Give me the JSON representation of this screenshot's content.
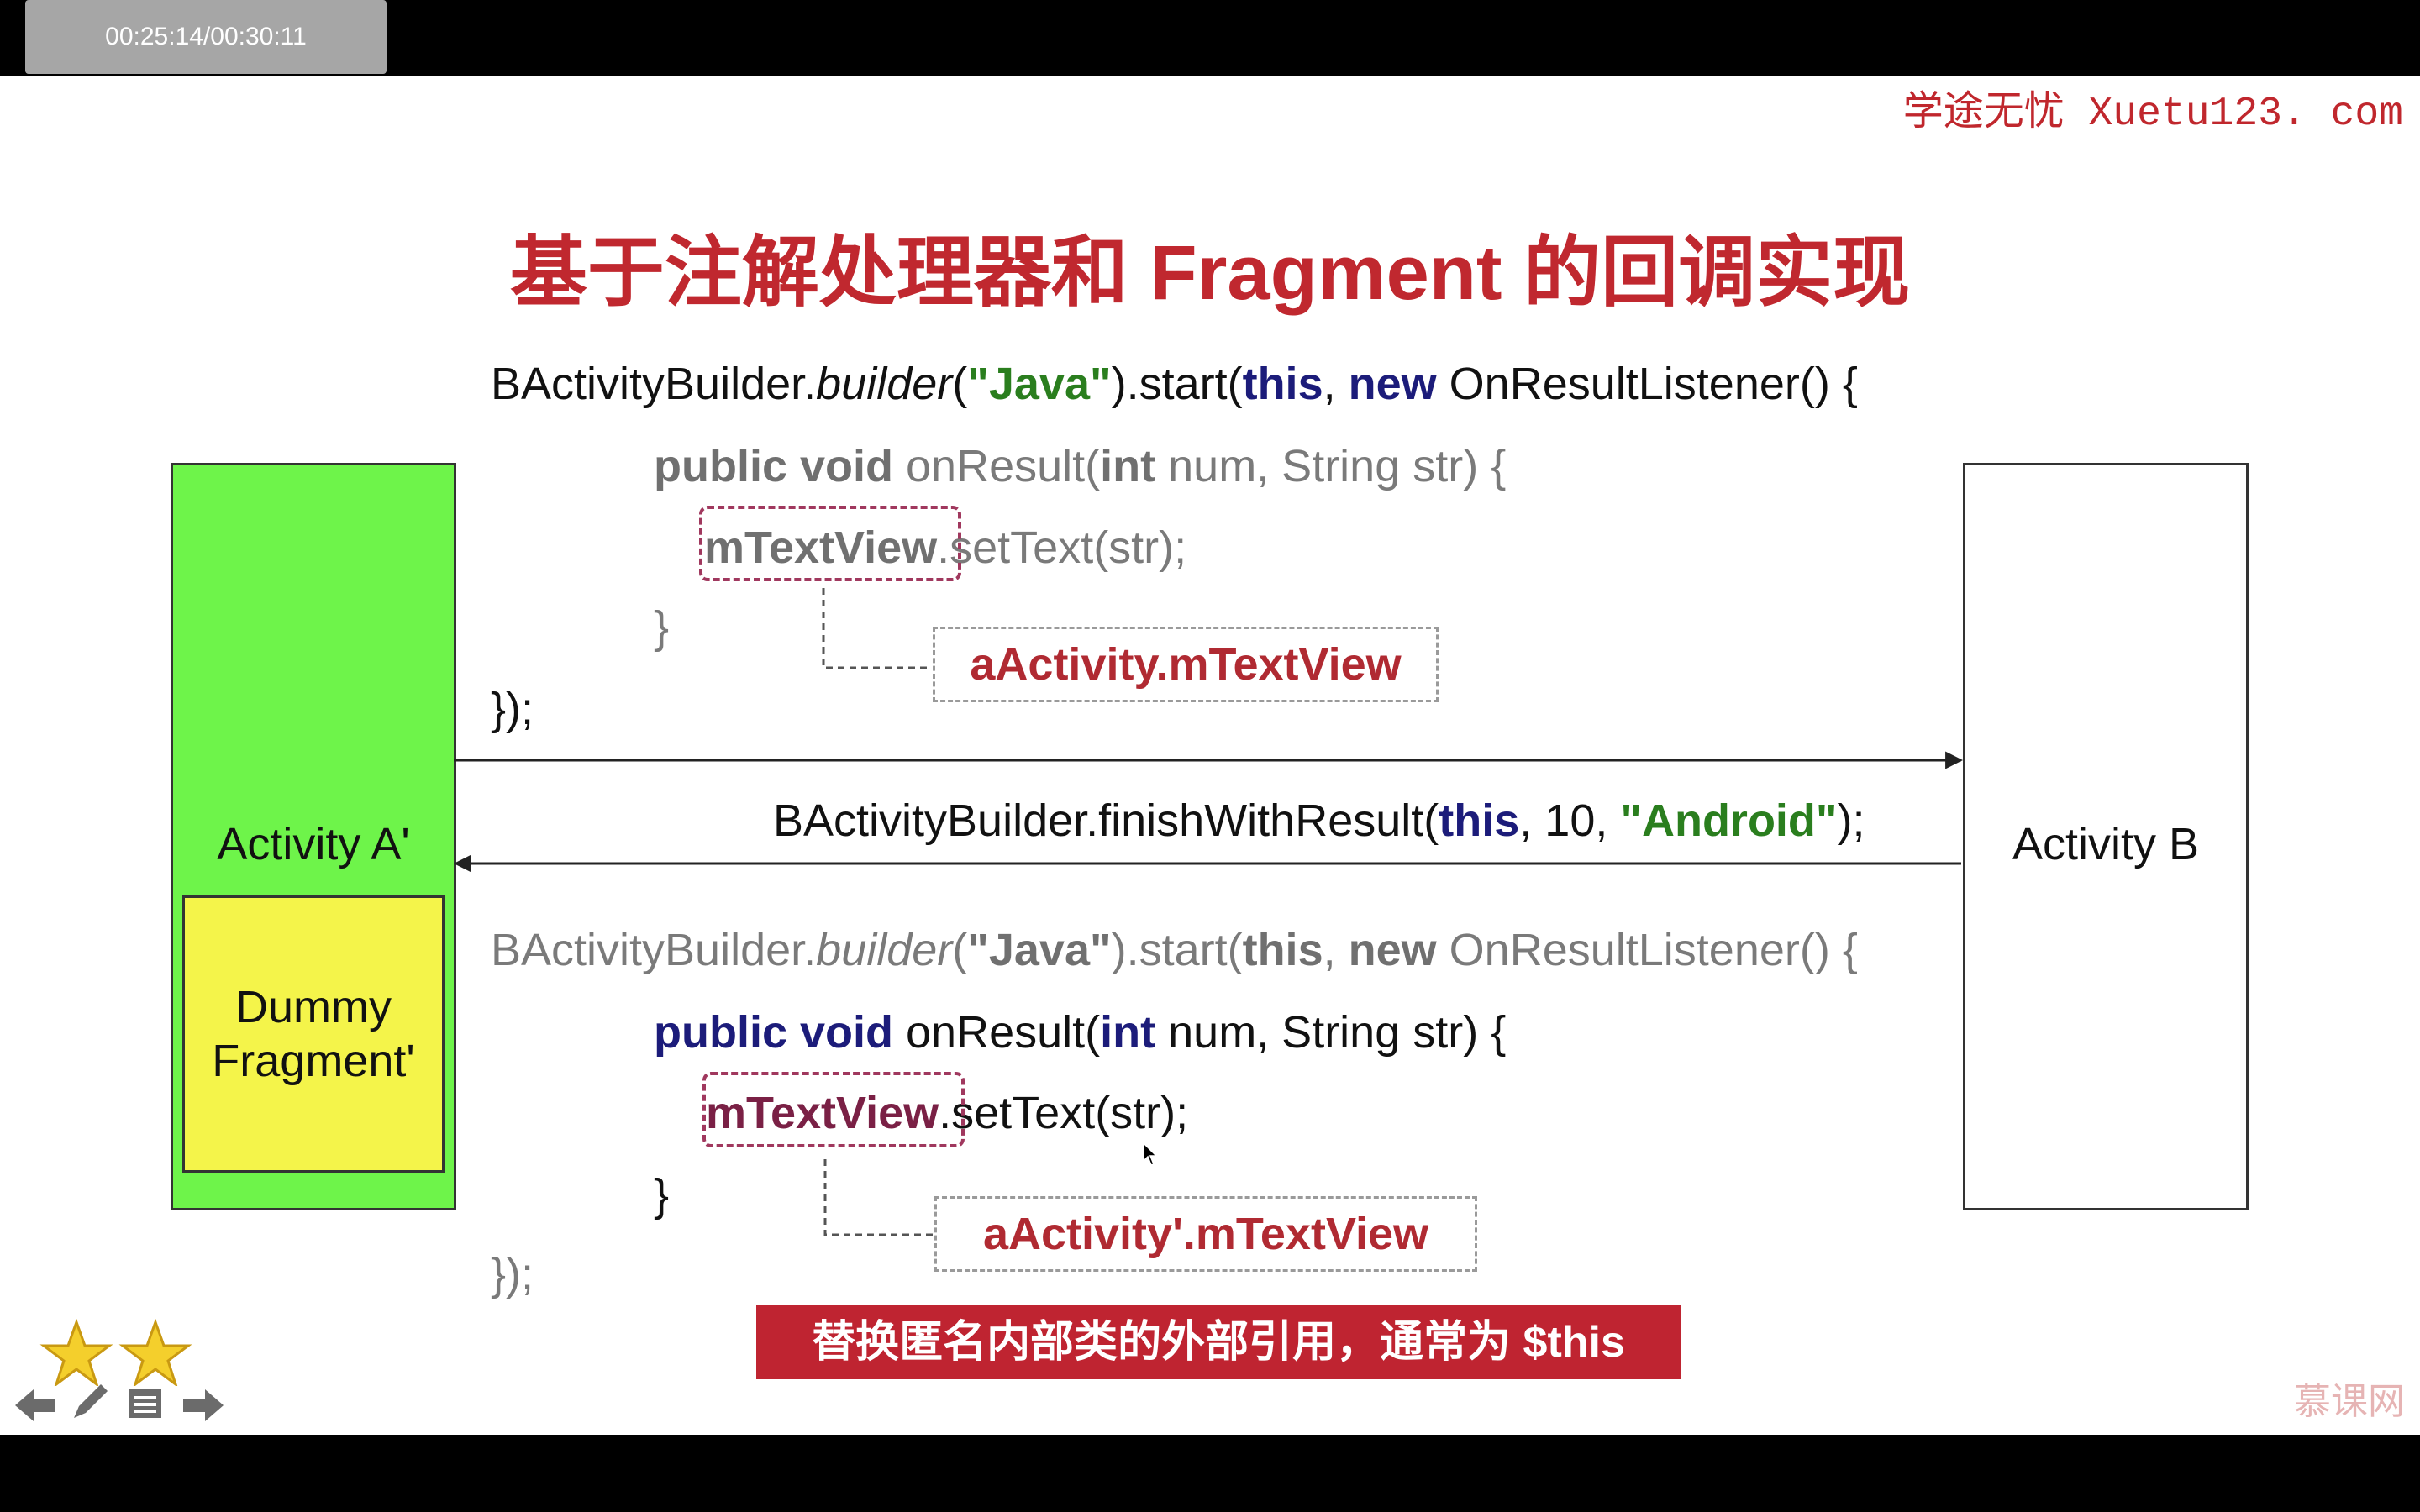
{
  "player": {
    "time": "00:25:14/00:30:11"
  },
  "watermark": {
    "brand": "学途无忧  Xuetu123. com",
    "logo": "慕课网"
  },
  "slide": {
    "title": "基于注解处理器和 Fragment 的回调实现",
    "activity_a": "Activity A'",
    "dummy_fragment": "Dummy Fragment'",
    "activity_b": "Activity B",
    "top_code": {
      "l1_a": "BActivityBuilder.",
      "l1_b": "builder",
      "l1_c": "(",
      "l1_str": "\"Java\"",
      "l1_d": ").start(",
      "l1_this": "this",
      "l1_e": ", ",
      "l1_new": "new",
      "l1_f": " OnResultListener() {",
      "l2_kw": "public void",
      "l2_a": " onResult(",
      "l2_int": "int",
      "l2_b": " num, String str) {",
      "l3_var": "mTextView",
      "l3_a": ".setText(str);",
      "l4": "}",
      "l5": "});"
    },
    "top_annotation": "aActivity.mTextView",
    "middle": {
      "a": "BActivityBuilder.finishWithResult(",
      "this": "this",
      "b": ", 10, ",
      "str": "\"Android\"",
      "c": ");"
    },
    "bottom_code": {
      "l1_a": "BActivityBuilder.",
      "l1_b": "builder",
      "l1_c": "(",
      "l1_str": "\"Java\"",
      "l1_d": ").start(",
      "l1_this": "this",
      "l1_e": ", ",
      "l1_new": "new",
      "l1_f": " OnResultListener() {",
      "l2_kw": "public void",
      "l2_a": " onResult(",
      "l2_int": "int",
      "l2_b": " num, String str) {",
      "l3_var": "mTextView",
      "l3_a": ".setText(str);",
      "l4": "}",
      "l5": "});"
    },
    "bottom_annotation": "aActivity'.mTextView",
    "banner": "替换匿名内部类的外部引用，通常为 $this"
  },
  "icons": [
    "star-icon",
    "star-icon",
    "arrow-left-icon",
    "pencil-icon",
    "menu-icon",
    "arrow-right-icon"
  ],
  "colors": {
    "title": "#c0282f",
    "activity_a": "#6ef44a",
    "dummy_fragment": "#f4f44a",
    "banner": "#bf2431",
    "keyword": "#1c1c7a",
    "string": "#2a7e1e"
  }
}
